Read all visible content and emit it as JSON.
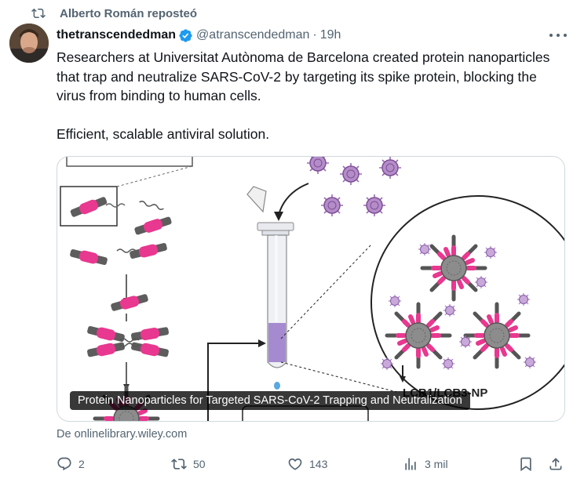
{
  "repost": {
    "label": "Alberto Román reposteó",
    "icon": "repost-icon"
  },
  "post": {
    "author_name": "thetranscendedman",
    "verified": true,
    "handle": "@atranscendedman",
    "separator": "·",
    "time": "19h",
    "paragraphs": [
      "Researchers at Universitat Autònoma de Barcelona created protein nanoparticles that trap and neutralize SARS-CoV-2 by targeting its spike protein, blocking the virus from binding to human cells.",
      "Efficient, scalable antiviral solution."
    ],
    "media": {
      "caption": "Protein Nanoparticles for Targeted SARS-CoV-2 Trapping and Neutralization",
      "figure_label": "LCB1/LCB3-NP"
    },
    "source": "De onlinelibrary.wiley.com"
  },
  "actions": {
    "replies": "2",
    "reposts": "50",
    "likes": "143",
    "views": "3 mil"
  },
  "colors": {
    "accent": "#1d9bf0",
    "muted": "#536471",
    "text": "#0f1419",
    "magenta": "#e8388f",
    "virus": "#9b6bb5",
    "border": "#cfd9de"
  }
}
